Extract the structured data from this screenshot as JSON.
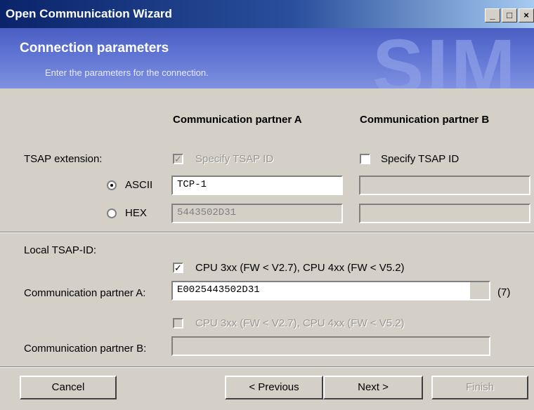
{
  "window": {
    "title": "Open Communication Wizard"
  },
  "header": {
    "title": "Connection parameters",
    "subtitle": "Enter the parameters for the connection.",
    "watermark": "SIM"
  },
  "columns": {
    "partner_a": "Communication partner A",
    "partner_b": "Communication partner B"
  },
  "tsap": {
    "label": "TSAP extension:",
    "specify_a": "Specify TSAP ID",
    "specify_b": "Specify TSAP ID",
    "ascii_label": "ASCII",
    "hex_label": "HEX",
    "ascii_value_a": "TCP-1",
    "hex_value_a": "5443502D31"
  },
  "local": {
    "label": "Local TSAP-ID:",
    "cpu_a": "CPU 3xx (FW < V2.7), CPU 4xx (FW < V5.2)",
    "partner_a_label": "Communication partner A:",
    "partner_a_value": "E0025443502D31",
    "partner_a_len": "(7)",
    "cpu_b": "CPU 3xx (FW < V2.7), CPU 4xx (FW < V5.2)",
    "partner_b_label": "Communication partner B:"
  },
  "buttons": {
    "cancel": "Cancel",
    "previous": "< Previous",
    "next": "Next >",
    "finish": "Finish"
  },
  "icons": {
    "minimize": "minimize-icon",
    "maximize": "maximize-icon",
    "close": "close-icon"
  }
}
